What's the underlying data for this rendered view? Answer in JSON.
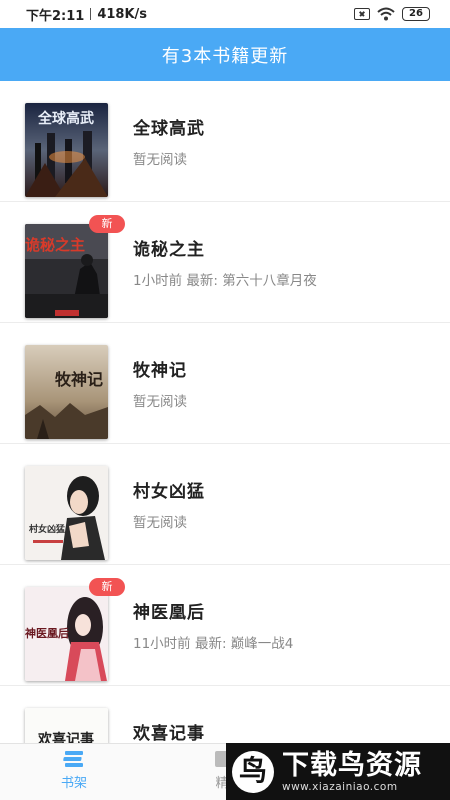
{
  "status_bar": {
    "time": "下午2:11",
    "speed": "418K/s",
    "battery": "26"
  },
  "header": {
    "title": "有3本书籍更新"
  },
  "books": [
    {
      "title": "全球高武",
      "status": "暂无阅读",
      "is_new": false,
      "cover_text": "全球高武"
    },
    {
      "title": "诡秘之主",
      "status": "1小时前 最新: 第六十八章月夜",
      "is_new": true,
      "cover_text": "诡秘之主"
    },
    {
      "title": "牧神记",
      "status": "暂无阅读",
      "is_new": false,
      "cover_text": "牧神记"
    },
    {
      "title": "村女凶猛",
      "status": "暂无阅读",
      "is_new": false,
      "cover_text": "村女凶猛"
    },
    {
      "title": "神医凰后",
      "status": "11小时前 最新: 巅峰一战4",
      "is_new": true,
      "cover_text": "神医凰后"
    },
    {
      "title": "欢喜记事",
      "status": "",
      "is_new": false,
      "cover_text": "欢喜记事"
    }
  ],
  "new_badge_label": "新",
  "tabs": {
    "shelf": "书架",
    "pick": "精"
  },
  "watermark": {
    "logo": "鸟",
    "title": "下载鸟资源",
    "url": "www.xiazainiao.com"
  },
  "colors": {
    "accent": "#4aa9f5",
    "badge": "#f25353"
  },
  "icons": {
    "shelf_tab": "bookshelf-icon",
    "pick_tab": "featured-icon",
    "wifi": "wifi-icon",
    "sim": "no-sim-icon",
    "battery": "battery-icon"
  }
}
